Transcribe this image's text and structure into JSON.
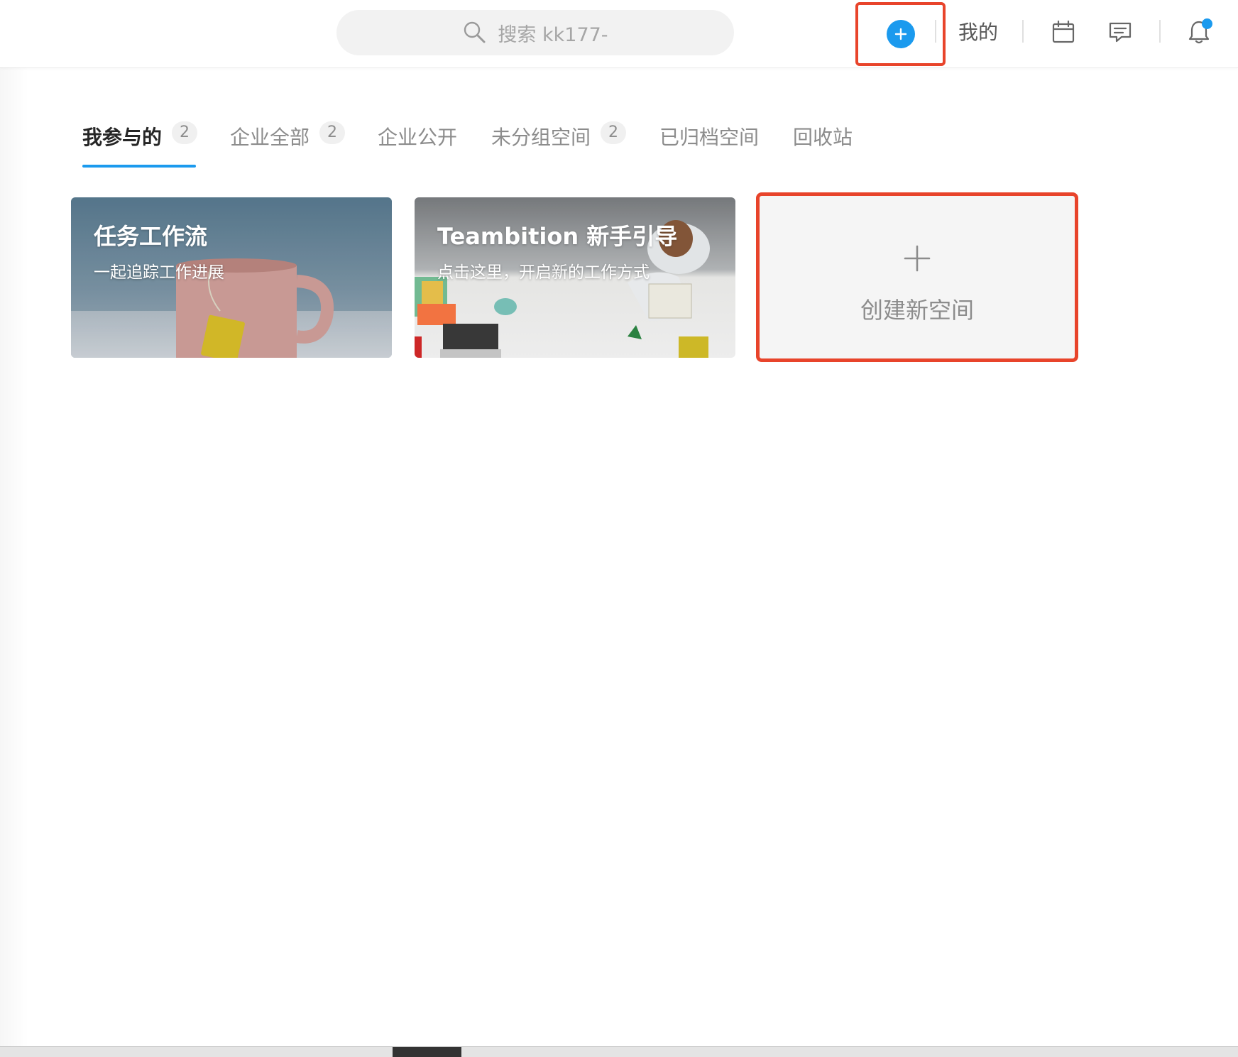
{
  "header": {
    "search_placeholder": "搜索 kk177-",
    "mine_label": "我的",
    "icons": [
      "search-icon",
      "plus-icon",
      "calendar-icon",
      "message-icon",
      "bell-icon"
    ],
    "notification_dot_color": "#1b9aee",
    "accent_color": "#1b9aee",
    "highlight_color": "#e8442b"
  },
  "tabs": [
    {
      "label": "我参与的",
      "count": "2",
      "active": true
    },
    {
      "label": "企业全部",
      "count": "2"
    },
    {
      "label": "企业公开"
    },
    {
      "label": "未分组空间",
      "count": "2"
    },
    {
      "label": "已归档空间"
    },
    {
      "label": "回收站"
    }
  ],
  "cards": [
    {
      "title": "任务工作流",
      "subtitle": "一起追踪工作进展"
    },
    {
      "title": "Teambition 新手引导",
      "subtitle": "点击这里，开启新的工作方式"
    }
  ],
  "create_card": {
    "label": "创建新空间"
  }
}
